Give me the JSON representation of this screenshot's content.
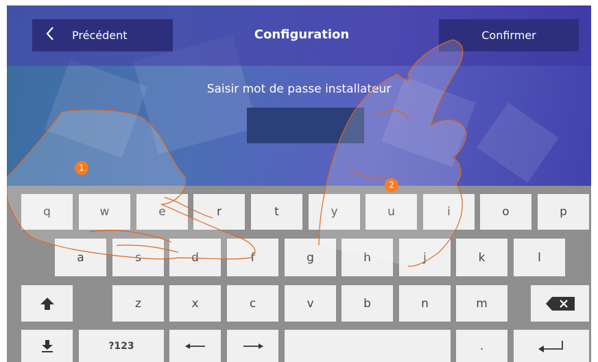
{
  "header": {
    "back_label": "Précédent",
    "title": "Configuration",
    "confirm_label": "Confirmer"
  },
  "form": {
    "prompt": "Saisir mot de passe installateur",
    "password_value": ""
  },
  "keyboard": {
    "row1": [
      "q",
      "w",
      "e",
      "r",
      "t",
      "y",
      "u",
      "i",
      "o",
      "p"
    ],
    "row2": [
      "a",
      "s",
      "d",
      "f",
      "g",
      "h",
      "j",
      "k",
      "l"
    ],
    "row3": [
      "z",
      "x",
      "c",
      "v",
      "b",
      "n",
      "m"
    ],
    "numbers_label": "?123",
    "period_label": "."
  },
  "annotations": {
    "step1": "1",
    "step2": "2",
    "color": "#ff7c1e"
  },
  "icons": [
    "chevron-left-icon",
    "shift-up-icon",
    "backspace-icon",
    "hide-keyboard-icon",
    "arrow-left-icon",
    "arrow-right-icon",
    "enter-icon"
  ]
}
